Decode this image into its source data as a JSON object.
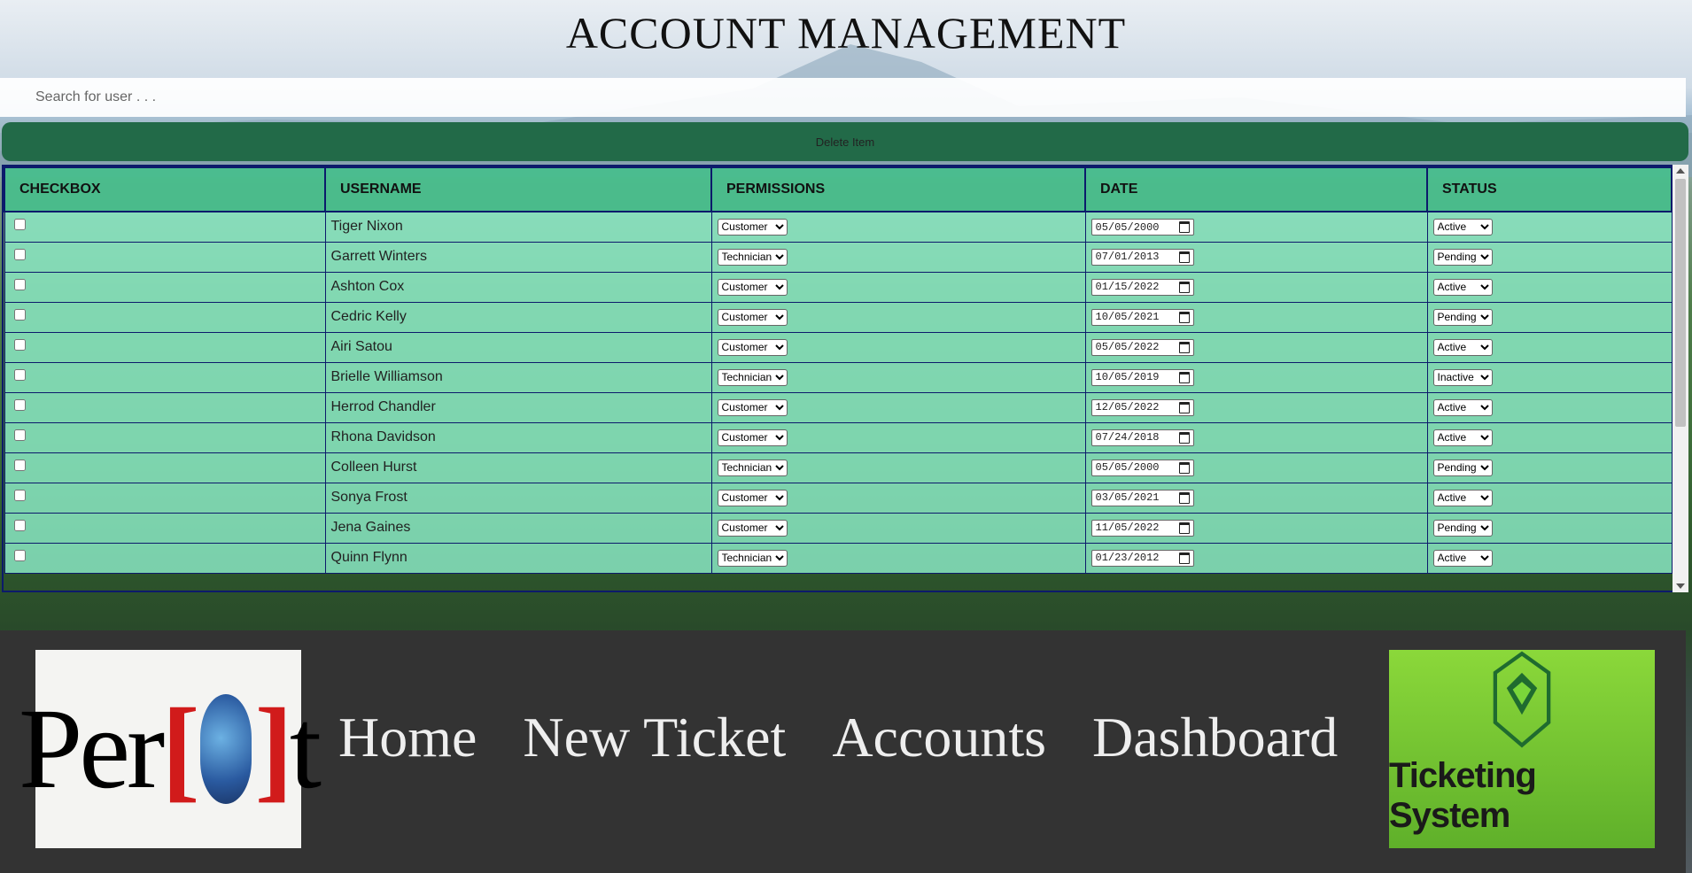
{
  "page": {
    "title": "ACCOUNT MANAGEMENT"
  },
  "search": {
    "placeholder": "Search for user . . ."
  },
  "toolbar": {
    "delete_label": "Delete Item"
  },
  "table": {
    "headers": [
      "CHECKBOX",
      "USERNAME",
      "PERMISSIONS",
      "DATE",
      "STATUS"
    ],
    "rows": [
      {
        "username": "Tiger Nixon",
        "permission": "Customer",
        "date": "05/05/2000",
        "status": "Active"
      },
      {
        "username": "Garrett Winters",
        "permission": "Technician",
        "date": "07/01/2013",
        "status": "Pending"
      },
      {
        "username": "Ashton Cox",
        "permission": "Customer",
        "date": "01/15/2022",
        "status": "Active"
      },
      {
        "username": "Cedric Kelly",
        "permission": "Customer",
        "date": "10/05/2021",
        "status": "Pending"
      },
      {
        "username": "Airi Satou",
        "permission": "Customer",
        "date": "05/05/2022",
        "status": "Active"
      },
      {
        "username": "Brielle Williamson",
        "permission": "Technician",
        "date": "10/05/2019",
        "status": "Inactive"
      },
      {
        "username": "Herrod Chandler",
        "permission": "Customer",
        "date": "12/05/2022",
        "status": "Active"
      },
      {
        "username": "Rhona Davidson",
        "permission": "Customer",
        "date": "07/24/2018",
        "status": "Active"
      },
      {
        "username": "Colleen Hurst",
        "permission": "Technician",
        "date": "05/05/2000",
        "status": "Pending"
      },
      {
        "username": "Sonya Frost",
        "permission": "Customer",
        "date": "03/05/2021",
        "status": "Active"
      },
      {
        "username": "Jena Gaines",
        "permission": "Customer",
        "date": "11/05/2022",
        "status": "Pending"
      },
      {
        "username": "Quinn Flynn",
        "permission": "Technician",
        "date": "01/23/2012",
        "status": "Active"
      }
    ]
  },
  "footer": {
    "logo_left_text": "Per[o]t",
    "nav": [
      "Home",
      "New Ticket",
      "Accounts",
      "Dashboard"
    ],
    "logo_right_text": "Ticketing System"
  },
  "colors": {
    "header_green": "#46be8c",
    "row_mint": "#8cebc8",
    "delete_button": "#226a48",
    "footer_bg": "#333333",
    "grid_border": "#0c1a6b"
  }
}
